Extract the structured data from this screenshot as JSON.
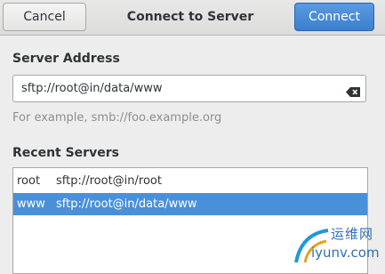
{
  "dialog": {
    "title": "Connect to Server",
    "cancel_label": "Cancel",
    "connect_label": "Connect"
  },
  "server_address": {
    "label": "Server Address",
    "value": "sftp://root@in/data/www",
    "hint": "For example, smb://foo.example.org"
  },
  "recent": {
    "label": "Recent Servers",
    "items": [
      {
        "name": "root",
        "url": "sftp://root@in/root",
        "selected": false
      },
      {
        "name": "www",
        "url": "sftp://root@in/data/www",
        "selected": true
      }
    ]
  },
  "watermark": {
    "line1": "运维网",
    "line2": "iyunv.com"
  },
  "colors": {
    "accent": "#4a90d9",
    "connect_button": "#3b7fcf"
  }
}
